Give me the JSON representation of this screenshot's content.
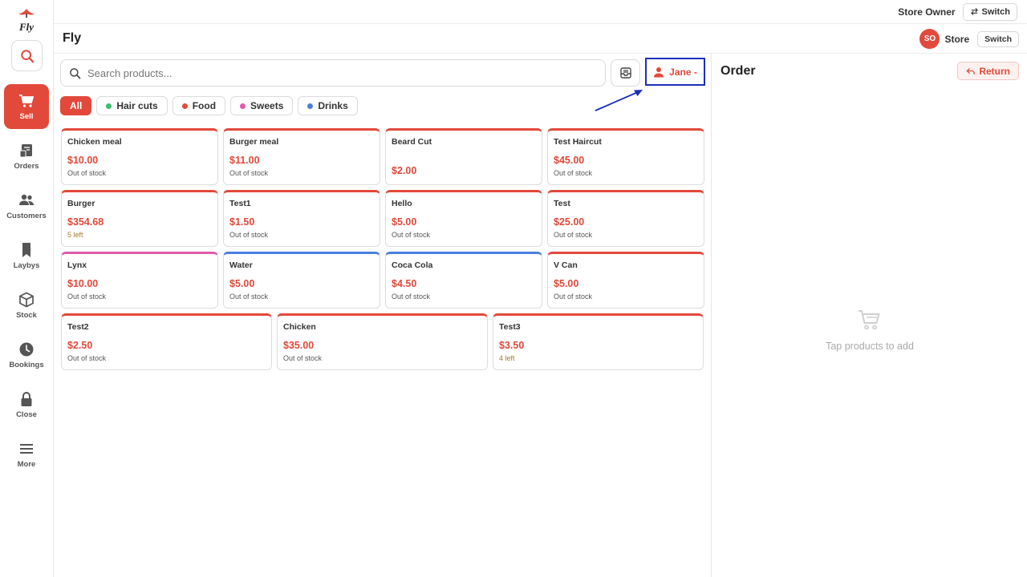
{
  "brand": {
    "logo_text": "Fly",
    "title": "Fly"
  },
  "topbar": {
    "role_label": "Store Owner",
    "switch_label": "Switch"
  },
  "subbar": {
    "avatar_initials": "SO",
    "store_label": "Store",
    "switch_label": "Switch"
  },
  "nav": {
    "items": [
      {
        "label": "Sell",
        "icon": "cart-icon",
        "active": true
      },
      {
        "label": "Orders",
        "icon": "orders-icon"
      },
      {
        "label": "Customers",
        "icon": "customers-icon"
      },
      {
        "label": "Laybys",
        "icon": "bookmark-icon"
      },
      {
        "label": "Stock",
        "icon": "box-icon"
      },
      {
        "label": "Bookings",
        "icon": "clock-icon"
      },
      {
        "label": "Close",
        "icon": "lock-icon"
      },
      {
        "label": "More",
        "icon": "menu-icon"
      }
    ]
  },
  "search": {
    "placeholder": "Search products..."
  },
  "customer_button": {
    "label": "Jane -"
  },
  "categories": [
    {
      "label": "All",
      "active": true
    },
    {
      "label": "Hair cuts",
      "color": "#3cbf6b"
    },
    {
      "label": "Food",
      "color": "#e2493b"
    },
    {
      "label": "Sweets",
      "color": "#e05aa8"
    },
    {
      "label": "Drinks",
      "color": "#4a7fe0"
    }
  ],
  "products": [
    [
      {
        "name": "Chicken meal",
        "price": "$10.00",
        "stock": "Out of stock",
        "color": "#e2493b"
      },
      {
        "name": "Burger meal",
        "price": "$11.00",
        "stock": "Out of stock",
        "color": "#e2493b"
      },
      {
        "name": "Beard Cut",
        "price": "$2.00",
        "stock": "",
        "color": "#e2493b"
      },
      {
        "name": "Test Haircut",
        "price": "$45.00",
        "stock": "Out of stock",
        "color": "#e2493b"
      }
    ],
    [
      {
        "name": "Burger",
        "price": "$354.68",
        "stock": "5 left",
        "color": "#e2493b"
      },
      {
        "name": "Test1",
        "price": "$1.50",
        "stock": "Out of stock",
        "color": "#e2493b"
      },
      {
        "name": "Hello",
        "price": "$5.00",
        "stock": "Out of stock",
        "color": "#e2493b"
      },
      {
        "name": "Test",
        "price": "$25.00",
        "stock": "Out of stock",
        "color": "#e2493b"
      }
    ],
    [
      {
        "name": "Lynx",
        "price": "$10.00",
        "stock": "Out of stock",
        "color": "#e05aa8"
      },
      {
        "name": "Water",
        "price": "$5.00",
        "stock": "Out of stock",
        "color": "#4a7fe0"
      },
      {
        "name": "Coca Cola",
        "price": "$4.50",
        "stock": "Out of stock",
        "color": "#4a7fe0"
      },
      {
        "name": "V Can",
        "price": "$5.00",
        "stock": "Out of stock",
        "color": "#e2493b"
      }
    ],
    [
      {
        "name": "Test2",
        "price": "$2.50",
        "stock": "Out of stock",
        "color": "#e2493b"
      },
      {
        "name": "Chicken",
        "price": "$35.00",
        "stock": "Out of stock",
        "color": "#e2493b"
      },
      {
        "name": "Test3",
        "price": "$3.50",
        "stock": "4 left",
        "color": "#e2493b"
      }
    ]
  ],
  "order": {
    "title": "Order",
    "return_label": "Return",
    "empty_message": "Tap products to add"
  },
  "colors": {
    "accent": "#e2493b",
    "highlight": "#1b2fb8"
  }
}
